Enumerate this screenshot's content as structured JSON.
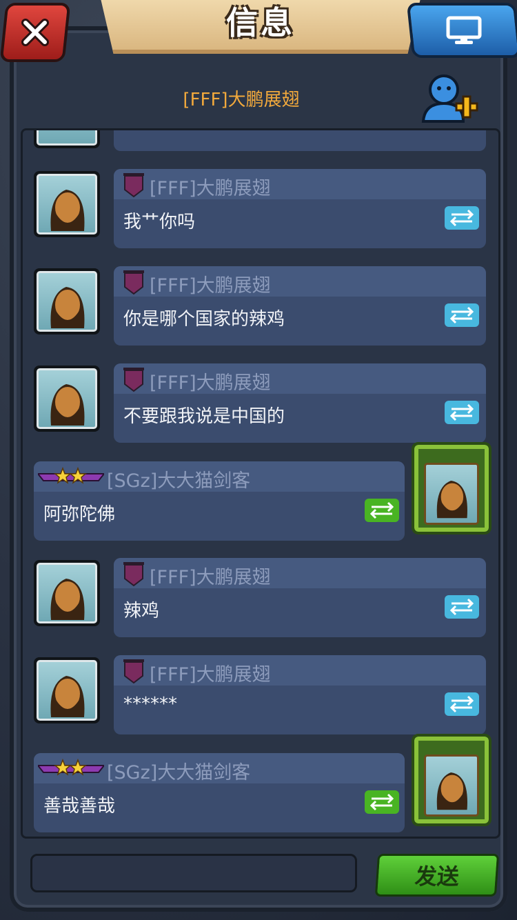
{
  "title": "信息",
  "header": {
    "name": "[FFF]大鹏展翅"
  },
  "messages": [
    {
      "side": "left",
      "sender": "[FFF]大鹏展翅",
      "text": "我艹你吗",
      "badge": "flag"
    },
    {
      "side": "left",
      "sender": "[FFF]大鹏展翅",
      "text": "你是哪个国家的辣鸡",
      "badge": "flag"
    },
    {
      "side": "left",
      "sender": "[FFF]大鹏展翅",
      "text": "不要跟我说是中国的",
      "badge": "flag"
    },
    {
      "side": "right",
      "sender": "[SGz]大大猫剑客",
      "text": "阿弥陀佛",
      "badge": "stars"
    },
    {
      "side": "left",
      "sender": "[FFF]大鹏展翅",
      "text": "辣鸡",
      "badge": "flag"
    },
    {
      "side": "left",
      "sender": "[FFF]大鹏展翅",
      "text": "******",
      "badge": "flag"
    },
    {
      "side": "right",
      "sender": "[SGz]大大猫剑客",
      "text": "善哉善哉",
      "badge": "stars"
    }
  ],
  "input": {
    "value": "",
    "placeholder": ""
  },
  "send_label": "发送",
  "colors": {
    "header_name": "#f2a93c",
    "sender_text": "#8d9cbc",
    "translate_blue": "#48b8df",
    "translate_green": "#49b423",
    "send_button": "#4dbb2a"
  }
}
